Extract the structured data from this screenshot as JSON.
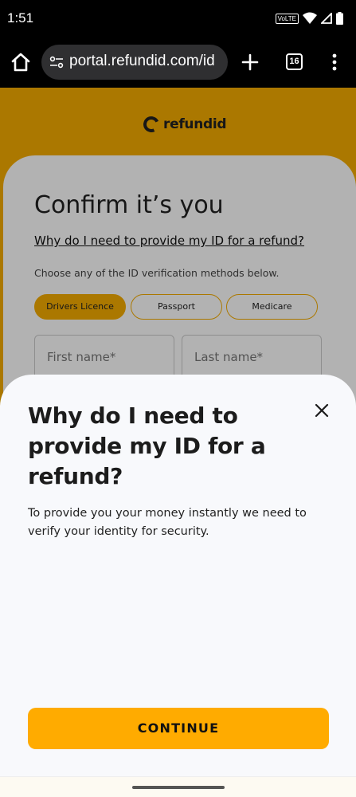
{
  "status_bar": {
    "time": "1:51",
    "network_badge": "VoLTE"
  },
  "browser": {
    "url": "portal.refundid.com/id",
    "tab_count": "16"
  },
  "page": {
    "logo_text": "refundid",
    "title": "Confirm it’s you",
    "why_link": "Why do I need to provide my ID for a refund?",
    "choose_text": "Choose any of the ID verification methods below.",
    "id_methods": [
      "Drivers Licence",
      "Passport",
      "Medicare"
    ],
    "selected_method": "Drivers Licence",
    "first_name_placeholder": "First name*",
    "last_name_placeholder": "Last name*"
  },
  "sheet": {
    "title": "Why do I need to provide my ID for a refund?",
    "body": "To provide you your money instantly we need to verify your identity for security.",
    "continue_label": "CONTINUE"
  },
  "colors": {
    "brand": "#f5ad00",
    "button": "#ffab00"
  }
}
